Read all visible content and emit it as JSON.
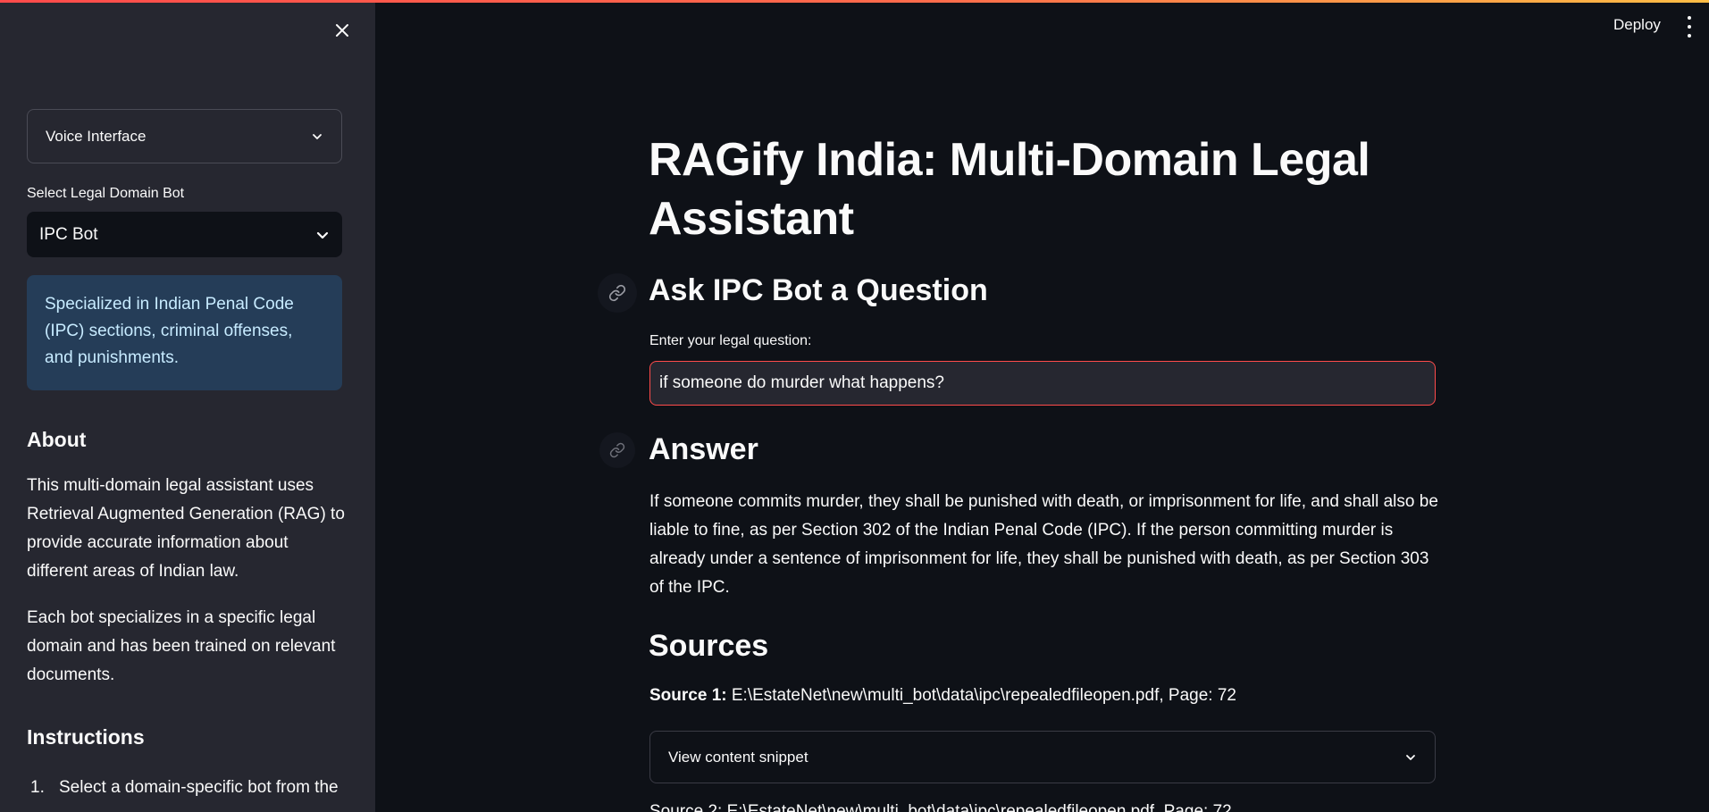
{
  "header": {
    "deploy_label": "Deploy"
  },
  "sidebar": {
    "voice_expander_label": "Voice Interface",
    "select_label": "Select Legal Domain Bot",
    "selected_bot": "IPC Bot",
    "info_text": "Specialized in Indian Penal Code (IPC) sections, criminal offenses, and punishments.",
    "about_heading": "About",
    "about_p1": "This multi-domain legal assistant uses Retrieval Augmented Generation (RAG) to provide accurate information about different areas of Indian law.",
    "about_p2": "Each bot specializes in a specific legal domain and has been trained on relevant documents.",
    "instructions_heading": "Instructions",
    "instruction_1_num": "1.",
    "instruction_1_text": "Select a domain-specific bot from the"
  },
  "main": {
    "title": "RAGify India: Multi-Domain Legal Assistant",
    "ask_heading": "Ask IPC Bot a Question",
    "input_label": "Enter your legal question:",
    "input_value": "if someone do murder what happens?",
    "answer_heading": "Answer",
    "answer_text": "If someone commits murder, they shall be punished with death, or imprisonment for life, and shall also be liable to fine, as per Section 302 of the Indian Penal Code (IPC). If the person committing murder is already under a sentence of imprisonment for life, they shall be punished with death, as per Section 303 of the IPC.",
    "sources_heading": "Sources",
    "source_1_label": "Source 1:",
    "source_1_path": "E:\\EstateNet\\new\\multi_bot\\data\\ipc\\repealedfileopen.pdf, Page: 72",
    "snippet_label": "View content snippet",
    "source_2_partial": "Source 2: E:\\EstateNet\\new\\multi_bot\\data\\ipc\\repealedfileopen.pdf, Page: 72"
  },
  "colors": {
    "background": "#0e1117",
    "sidebar": "#262730",
    "info_bg": "#253d58",
    "info_text": "#c7ebff",
    "accent": "#ff4b4b"
  },
  "icons": {
    "close": "close-icon",
    "chevron": "chevron-down-icon",
    "link": "link-icon",
    "menu": "more-vertical-icon"
  }
}
